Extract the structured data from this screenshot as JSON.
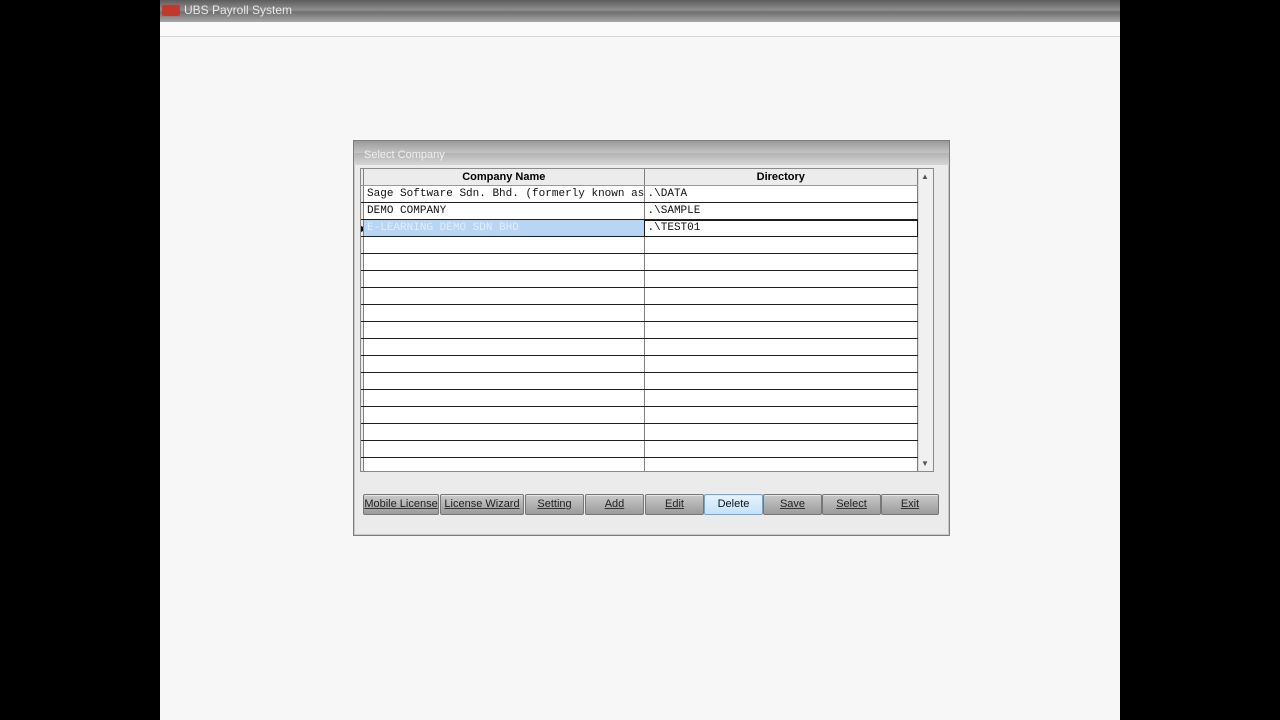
{
  "window": {
    "title": "UBS Payroll System"
  },
  "dialog": {
    "title": "Select Company",
    "columns": [
      "Company Name",
      "Directory"
    ],
    "rows": [
      {
        "name": "Sage Software Sdn. Bhd. (formerly known as",
        "dir": ".\\DATA"
      },
      {
        "name": "DEMO COMPANY",
        "dir": ".\\SAMPLE"
      },
      {
        "name": "E-LEARNING DEMO SDN BHD",
        "dir": ".\\TEST01"
      }
    ],
    "selected_row": 2,
    "buttons": {
      "mobile_license": "Mobile License",
      "license_wizard": "License Wizard",
      "setting": "Setting",
      "add": "Add",
      "edit": "Edit",
      "delete": "Delete",
      "save": "Save",
      "select": "Select",
      "exit": "Exit"
    }
  },
  "colors": {
    "selection": "#b8d5f4",
    "active_button": "#c4e2fa"
  }
}
